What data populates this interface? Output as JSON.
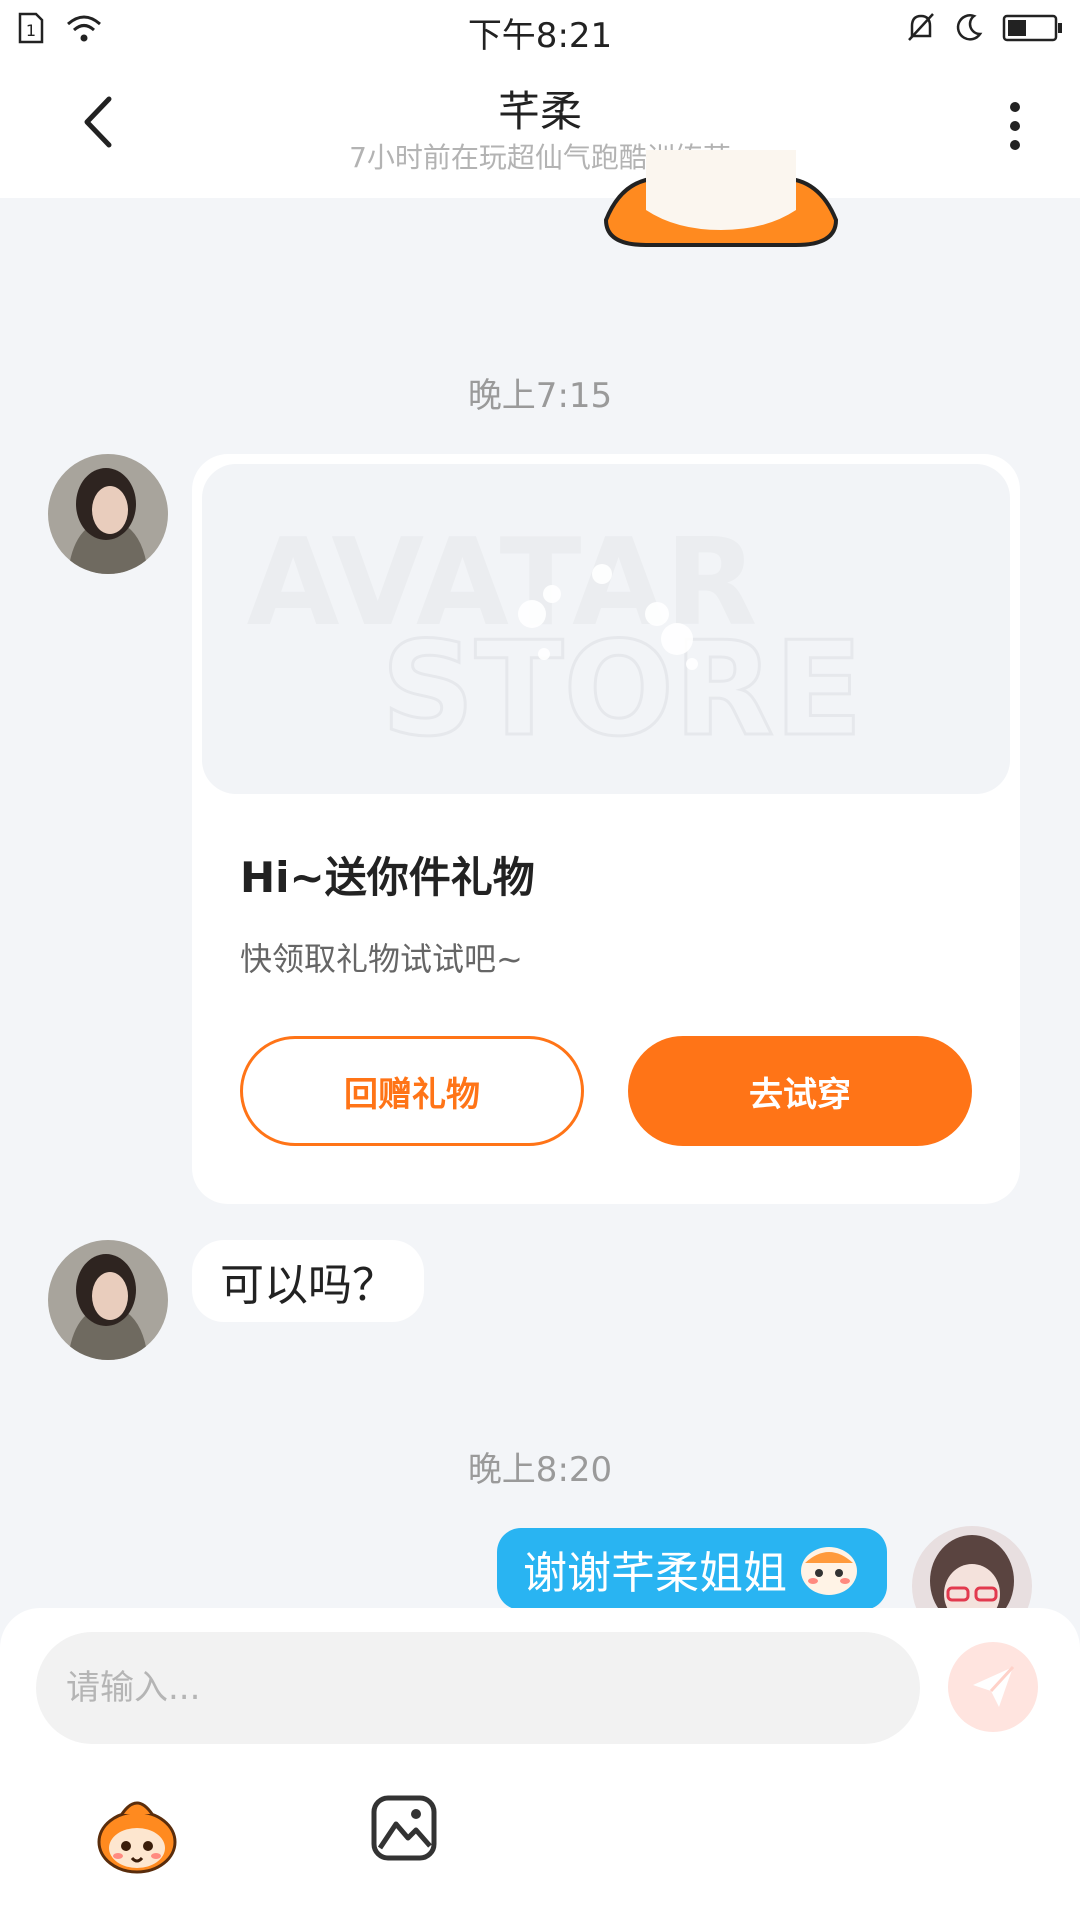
{
  "status_bar": {
    "time": "下午8:21",
    "icons": [
      "sim-card-icon",
      "wifi-icon",
      "bell-muted-icon",
      "moon-icon",
      "battery-icon"
    ]
  },
  "header": {
    "title": "芊柔",
    "subtitle": "7小时前在玩超仙气跑酷训练营",
    "back_icon": "chevron-left-icon",
    "more_icon": "more-vertical-icon"
  },
  "chat": {
    "timestamp_1": "晚上7:15",
    "gift_card": {
      "banner_text_1": "AVATAR",
      "banner_text_2": "STORE",
      "title": "Hi~送你件礼物",
      "description": "快领取礼物试试吧~",
      "return_gift_label": "回赠礼物",
      "try_on_label": "去试穿"
    },
    "message_1": "可以吗？",
    "timestamp_2": "晚上8:20",
    "message_2": "谢谢芊柔姐姐"
  },
  "composer": {
    "placeholder": "请输入...",
    "send_icon": "paper-plane-icon",
    "emoji_tool_icon": "mascot-emoji-icon",
    "image_tool_icon": "image-icon"
  },
  "colors": {
    "accent_orange": "#ff7417",
    "bubble_blue": "#29b4f2",
    "background": "#f3f5f8"
  }
}
